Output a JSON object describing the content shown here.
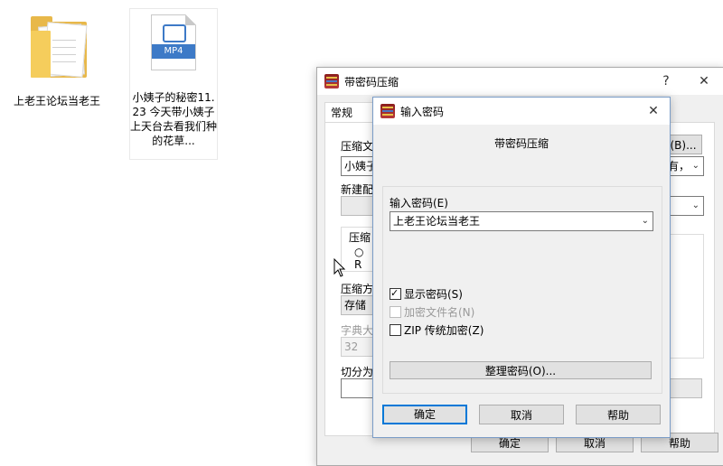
{
  "desktop": {
    "folder_label": "上老王论坛当老王",
    "mp4_label": "小姨子的秘密11.23 今天带小姨子上天台去看我们种的花草...",
    "mp4_badge": "MP4"
  },
  "back_dialog": {
    "title": "带密码压缩",
    "help_btn": "?",
    "close_btn": "✕",
    "tab": "常规",
    "label_archive": "压缩文",
    "archive_value": "小姨子",
    "browse_btn": "(B)...",
    "update_value": "有，",
    "label_profile": "新建配",
    "label_format": "压缩",
    "radio_partial": "R",
    "label_method": "压缩方",
    "method_value": "存储",
    "label_dict": "字典大",
    "dict_value": "32",
    "label_split": "切分为",
    "ok_btn": "确定",
    "cancel_btn": "取消",
    "help_btn2": "帮助"
  },
  "pwd_dialog": {
    "title": "输入密码",
    "close_btn": "✕",
    "heading": "带密码压缩",
    "label_password": "输入密码(E)",
    "password_value": "上老王论坛当老王",
    "show_password": "显示密码(S)",
    "show_password_checked": true,
    "encrypt_names": "加密文件名(N)",
    "encrypt_names_checked": false,
    "zip_legacy": "ZIP 传统加密(Z)",
    "zip_legacy_checked": false,
    "organize_btn": "整理密码(O)...",
    "ok_btn": "确定",
    "cancel_btn": "取消",
    "help_btn": "帮助"
  },
  "colors": {
    "accent": "#0078d7",
    "folder": "#e8b84a",
    "mp4_band": "#3d7ac7"
  }
}
